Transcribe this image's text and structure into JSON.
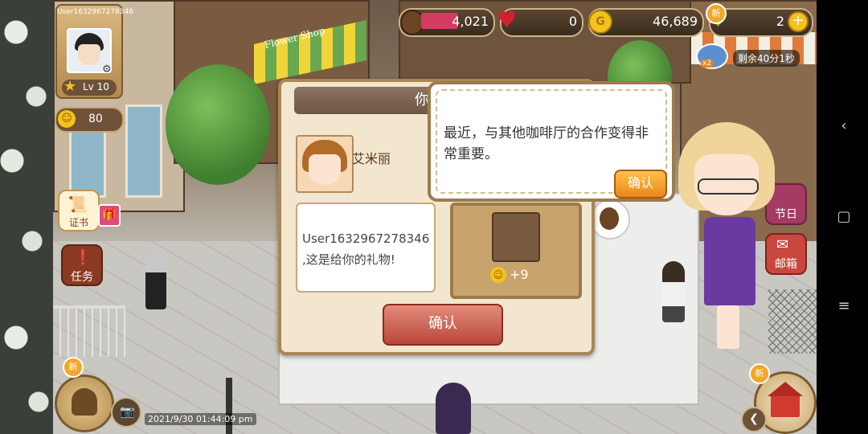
{
  "player": {
    "username": "User1632967278346",
    "level": "Lv 10",
    "reputation": "80"
  },
  "resources": {
    "coffee_beans": "4,021",
    "hearts": "0",
    "gold": "46,689",
    "gems": "2"
  },
  "boost": {
    "multiplier": "x2",
    "timer": "剩余40分1秒"
  },
  "signs": {
    "flower_shop": "Flower Shop"
  },
  "gift_dialog": {
    "title": "你收到",
    "sender_name": "艾米丽",
    "message": "User1632967278346\n,这是给你的礼物!",
    "gift_value": "+9",
    "confirm_label": "确认"
  },
  "speech_bubble": {
    "text": "最近，与其他咖啡厅的合作变得非常重要。",
    "confirm_label": "确认"
  },
  "side_menu": {
    "certificate": "证书",
    "quests": "任务",
    "events": "节日",
    "mailbox": "邮箱"
  },
  "badges": {
    "new": "新"
  },
  "timestamp": "2021/9/30 01:44:09 pm",
  "colors": {
    "dialog_bg": "#f2e6cf",
    "confirm_red": "#b8473b",
    "confirm_orange": "#e8871a"
  }
}
